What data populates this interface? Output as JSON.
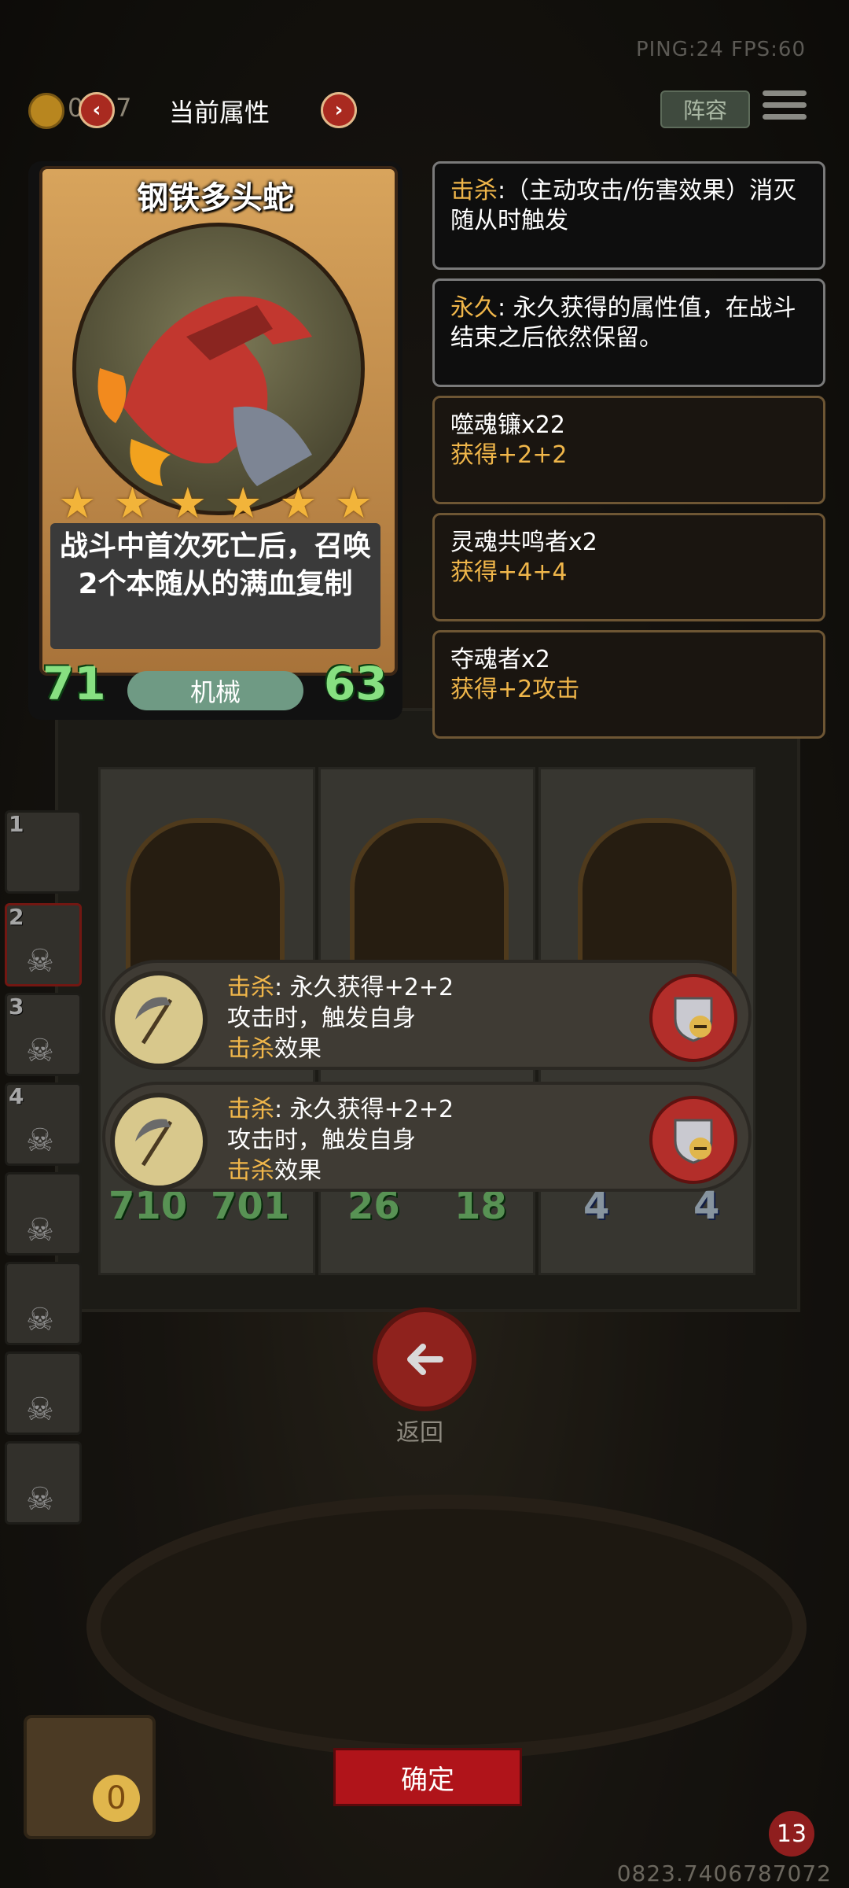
{
  "status": {
    "perf_text": "PING:24   FPS:60"
  },
  "header": {
    "coin_count": "0217",
    "title": "当前属性",
    "prev_symbol": "‹",
    "next_symbol": "›",
    "lineup_label": "阵容"
  },
  "card": {
    "name": "钢铁多头蛇",
    "stars": 6,
    "description": "战斗中首次死亡后，召唤2个本随从的满血复制",
    "attack": "71",
    "health": "63",
    "tribe": "机械"
  },
  "panels": [
    {
      "keyword": "击杀",
      "text": ":（主动攻击/伤害效果）消灭随从时触发"
    },
    {
      "keyword": "永久",
      "text": ": 永久获得的属性值，在战斗结束之后依然保留。"
    },
    {
      "title": "噬魂镰x22",
      "gain": "获得+2+2"
    },
    {
      "title": "灵魂共鸣者x2",
      "gain": "获得+4+4"
    },
    {
      "title": "夺魂者x2",
      "gain": "获得+2攻击"
    }
  ],
  "lineup_numbers": [
    "1",
    "2",
    "3",
    "4"
  ],
  "board_stats": [
    {
      "atk": "710",
      "hp": "701"
    },
    {
      "atk": "26",
      "hp": "18"
    },
    {
      "atk": "4",
      "hp": "4"
    }
  ],
  "effects": [
    {
      "kw": "击杀",
      "line1": ": 永久获得+2+2",
      "line2": "攻击时，触发自身",
      "kw2": "击杀",
      "line3": "效果"
    },
    {
      "kw": "击杀",
      "line1": ": 永久获得+2+2",
      "line2": "攻击时，触发自身",
      "kw2": "击杀",
      "line3": "效果"
    }
  ],
  "back_label": "返回",
  "confirm_label": "确定",
  "gold_value": "0",
  "hero_health": "13",
  "footer_id": "0823.7406787072",
  "colors": {
    "keyword": "#f0b64a",
    "stat_green": "#87e081",
    "confirm_red": "#b0141a"
  }
}
